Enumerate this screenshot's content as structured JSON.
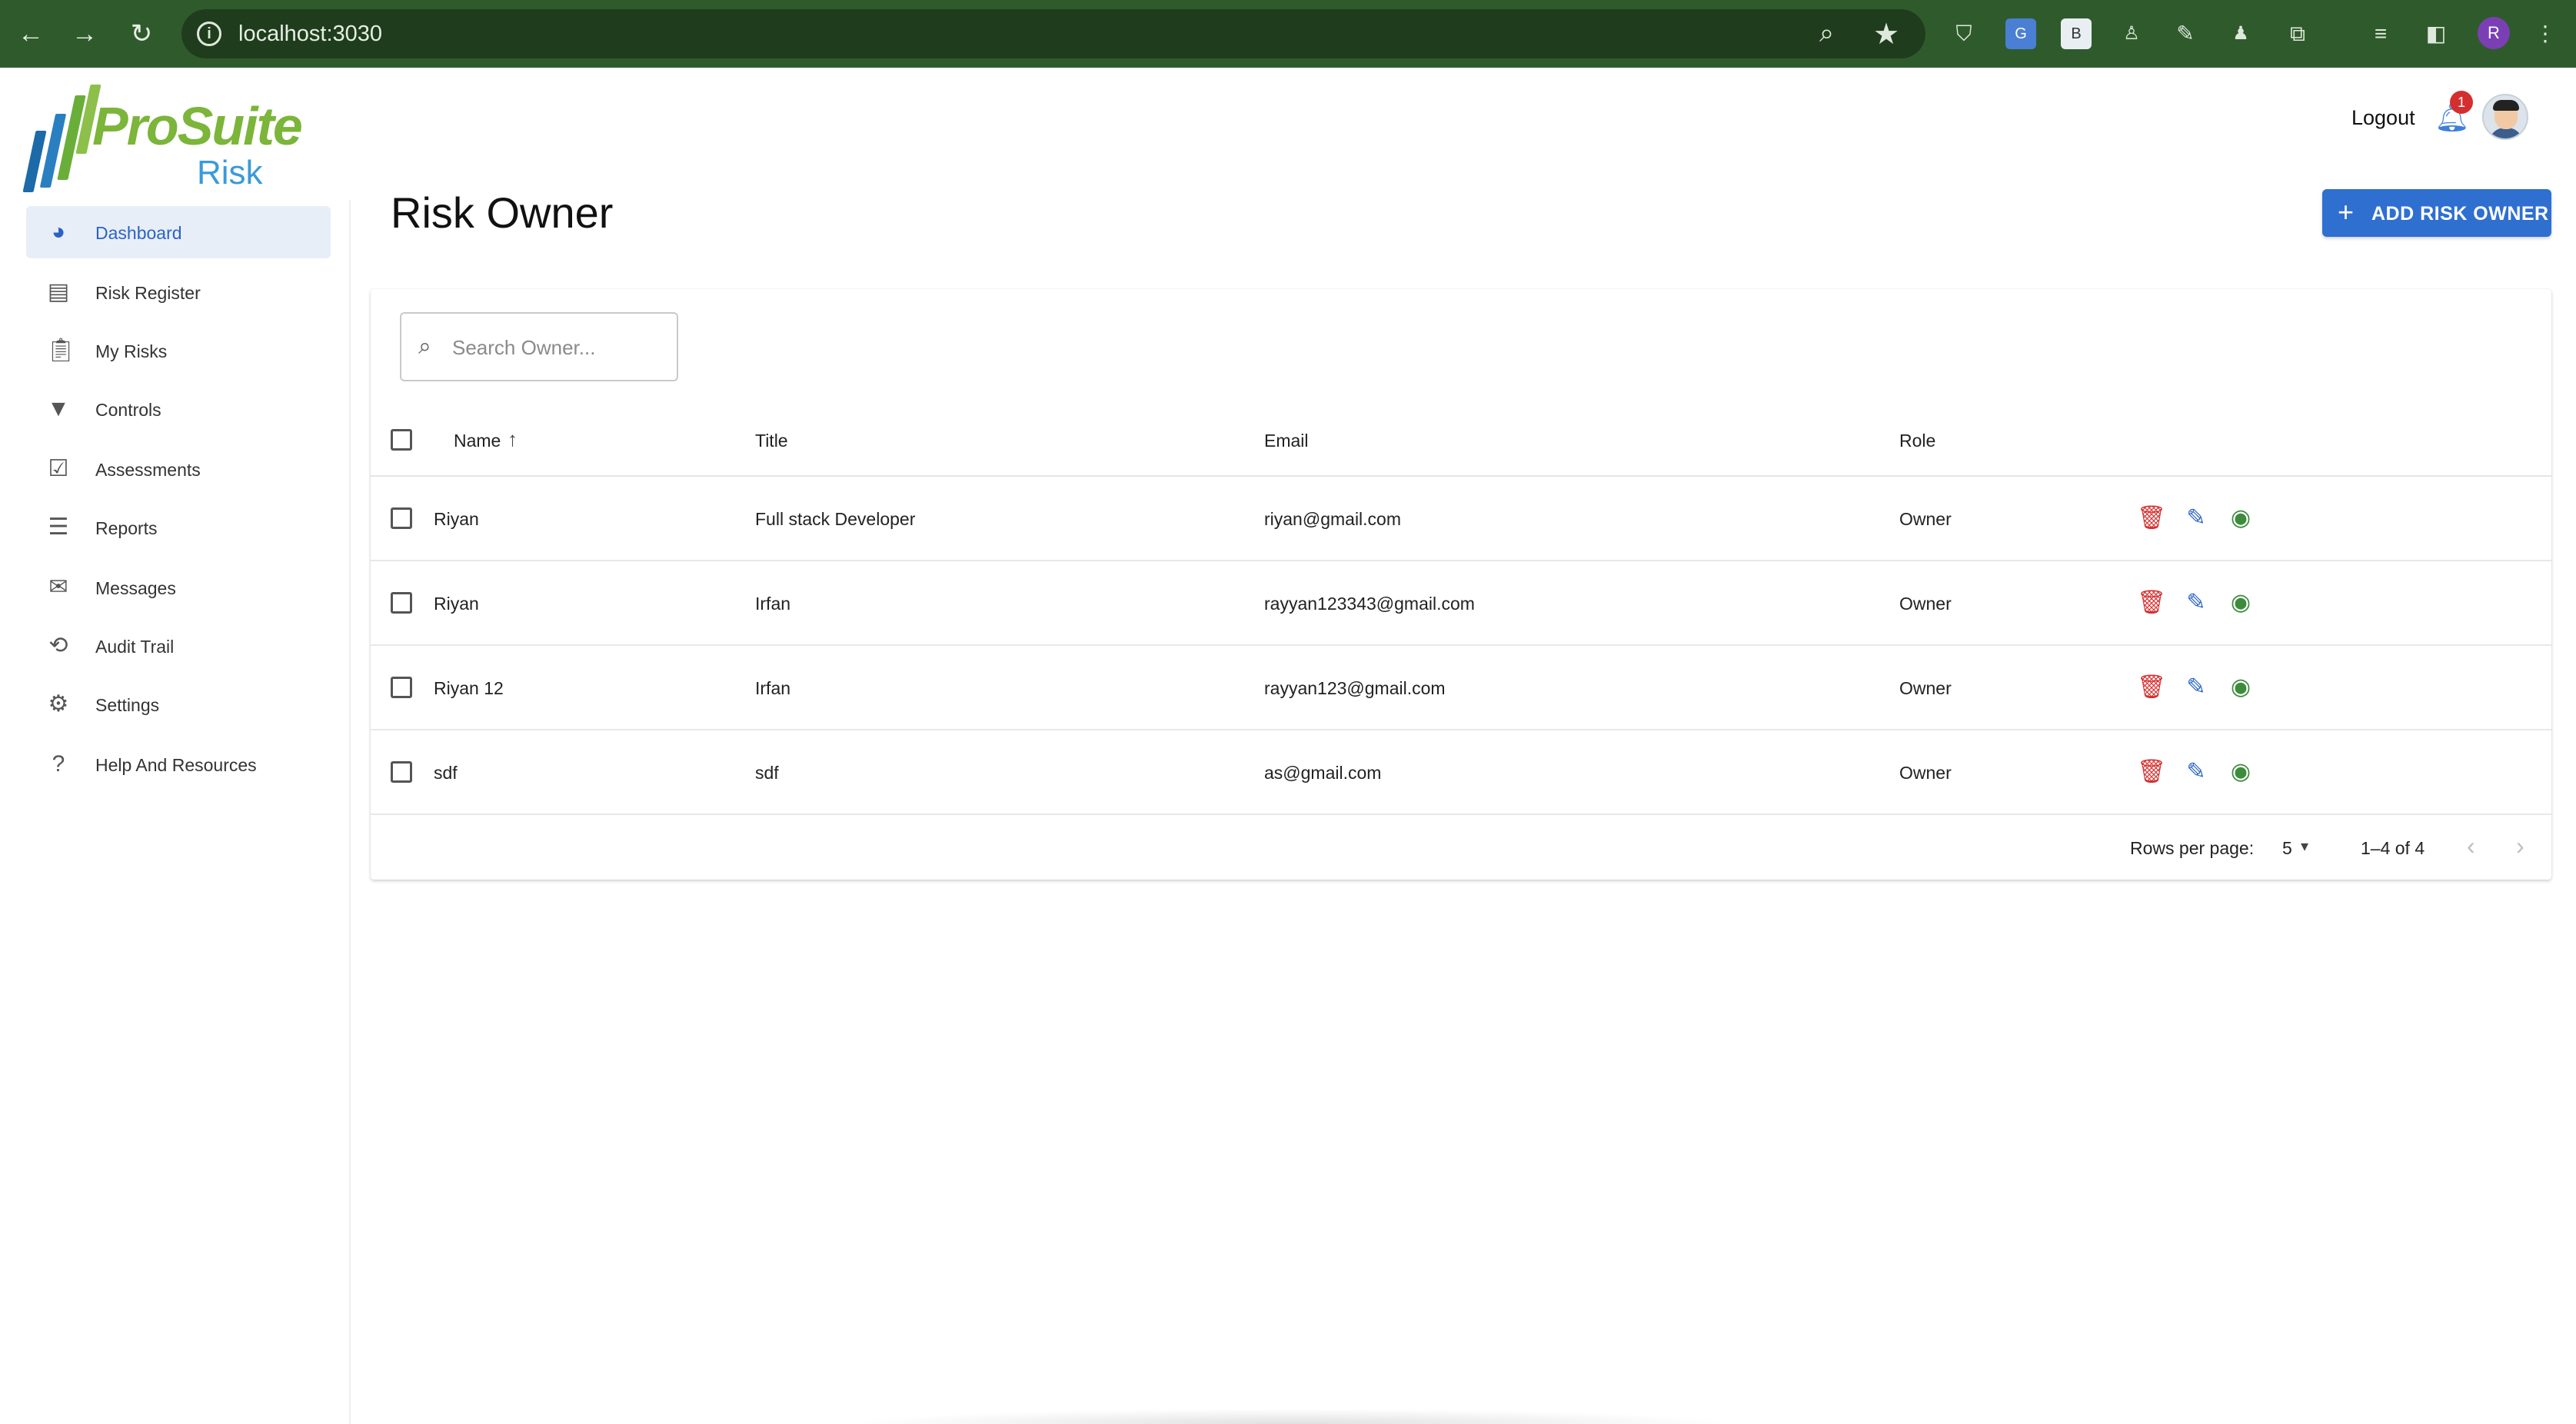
{
  "browser": {
    "url": "localhost:3030",
    "profile_initial": "R"
  },
  "app": {
    "logo_text_1": "ProSuite",
    "logo_text_2": "Risk",
    "logout_label": "Logout",
    "notification_count": "1"
  },
  "sidebar": {
    "items": [
      {
        "label": "Dashboard",
        "icon": "pie-chart-icon",
        "active": true
      },
      {
        "label": "Risk Register",
        "icon": "report-icon",
        "active": false
      },
      {
        "label": "My Risks",
        "icon": "clipboard-icon",
        "active": false
      },
      {
        "label": "Controls",
        "icon": "filter-icon",
        "active": false
      },
      {
        "label": "Assessments",
        "icon": "checklist-icon",
        "active": false
      },
      {
        "label": "Reports",
        "icon": "layers-icon",
        "active": false
      },
      {
        "label": "Messages",
        "icon": "mail-icon",
        "active": false
      },
      {
        "label": "Audit Trail",
        "icon": "history-icon",
        "active": false
      },
      {
        "label": "Settings",
        "icon": "gear-icon",
        "active": false
      },
      {
        "label": "Help And Resources",
        "icon": "help-icon",
        "active": false
      }
    ]
  },
  "page": {
    "title": "Risk Owner",
    "add_button_label": "ADD RISK OWNER"
  },
  "search": {
    "placeholder": "Search Owner..."
  },
  "table": {
    "columns": [
      "Name",
      "Title",
      "Email",
      "Role"
    ],
    "rows": [
      {
        "name": "Riyan",
        "title": "Full stack Developer",
        "email": "riyan@gmail.com",
        "role": "Owner"
      },
      {
        "name": "Riyan",
        "title": "Irfan",
        "email": "rayyan123343@gmail.com",
        "role": "Owner"
      },
      {
        "name": "Riyan 12",
        "title": "Irfan",
        "email": "rayyan123@gmail.com",
        "role": "Owner"
      },
      {
        "name": "sdf",
        "title": "sdf",
        "email": "as@gmail.com",
        "role": "Owner"
      }
    ]
  },
  "pagination": {
    "rows_per_page_label": "Rows per page:",
    "rows_per_page_value": "5",
    "range": "1–4 of 4"
  },
  "colors": {
    "accent": "#2f6fd0",
    "chrome": "#2f5b2c",
    "delete": "#d32f2f",
    "view": "#3c8c3c"
  }
}
